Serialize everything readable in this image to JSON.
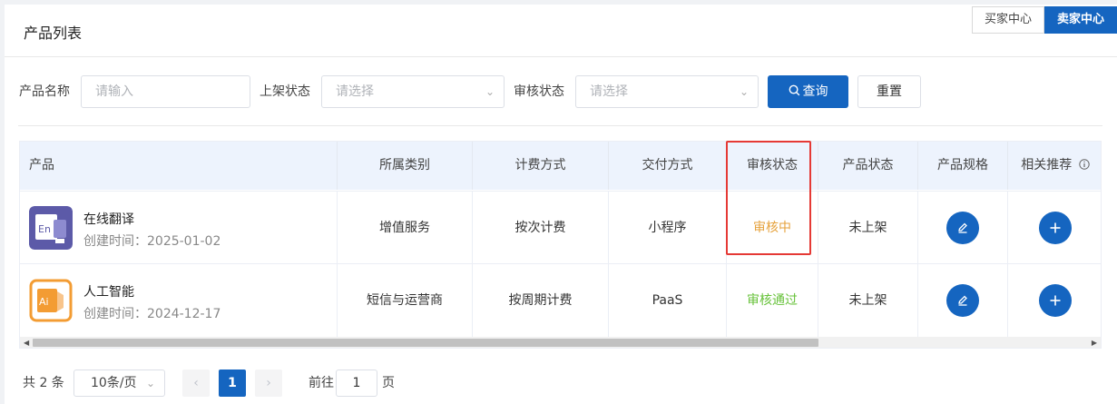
{
  "header": {
    "title": "产品列表",
    "switch_buyer": "买家中心",
    "switch_seller": "卖家中心"
  },
  "filters": {
    "name_label": "产品名称",
    "name_placeholder": "请输入",
    "listing_label": "上架状态",
    "listing_placeholder": "请选择",
    "audit_label": "审核状态",
    "audit_placeholder": "请选择",
    "query_label": "查询",
    "reset_label": "重置"
  },
  "table": {
    "columns": [
      "产品",
      "所属类别",
      "计费方式",
      "交付方式",
      "审核状态",
      "产品状态",
      "产品规格",
      "相关推荐"
    ],
    "rows": [
      {
        "name": "在线翻译",
        "created": "创建时间：2025-01-02",
        "category": "增值服务",
        "billing": "按次计费",
        "delivery": "小程序",
        "audit": "审核中",
        "status": "未上架",
        "thumb_text": "En"
      },
      {
        "name": "人工智能",
        "created": "创建时间：2024-12-17",
        "category": "短信与运营商",
        "billing": "按周期计费",
        "delivery": "PaaS",
        "audit": "审核通过",
        "status": "未上架",
        "thumb_text": "Ai"
      }
    ]
  },
  "pagination": {
    "total": "共 2 条",
    "page_size": "10条/页",
    "current_page": "1",
    "goto_prefix": "前往",
    "goto_value": "1",
    "goto_suffix": "页"
  },
  "colors": {
    "primary": "#1565c0",
    "reviewing": "#e6a23c",
    "approved": "#67c23a",
    "highlight": "#e53935"
  }
}
